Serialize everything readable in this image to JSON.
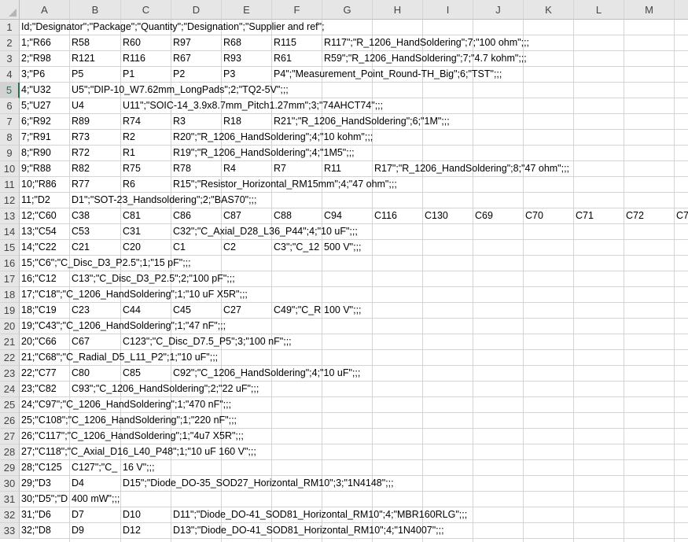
{
  "columns": [
    "A",
    "B",
    "C",
    "D",
    "E",
    "F",
    "G",
    "H",
    "I",
    "J",
    "K",
    "L",
    "M"
  ],
  "selected_row": 5,
  "rows": [
    {
      "n": "1",
      "cells": [
        "Id;\"Designator\";\"Package\";\"Quantity\";\"Designation\";\"Supplier and ref\";"
      ]
    },
    {
      "n": "2",
      "cells": [
        "1;\"R66",
        "R58",
        "R60",
        "R97",
        "R68",
        "R115",
        "R117\";\"R_1206_HandSoldering\";7;\"100 ohm\";;;"
      ]
    },
    {
      "n": "3",
      "cells": [
        "2;\"R98",
        "R121",
        "R116",
        "R67",
        "R93",
        "R61",
        "R59\";\"R_1206_HandSoldering\";7;\"4.7 kohm\";;;"
      ]
    },
    {
      "n": "4",
      "cells": [
        "3;\"P6",
        "P5",
        "P1",
        "P2",
        "P3",
        "P4\";\"Measurement_Point_Round-TH_Big\";6;\"TST\";;;"
      ]
    },
    {
      "n": "5",
      "cells": [
        "4;\"U32",
        "U5\";\"DIP-10_W7.62mm_LongPads\";2;\"TQ2-5V\";;;"
      ]
    },
    {
      "n": "6",
      "cells": [
        "5;\"U27",
        "U4",
        "U11\";\"SOIC-14_3.9x8.7mm_Pitch1.27mm\";3;\"74AHCT74\";;;"
      ]
    },
    {
      "n": "7",
      "cells": [
        "6;\"R92",
        "R89",
        "R74",
        "R3",
        "R18",
        "R21\";\"R_1206_HandSoldering\";6;\"1M\";;;"
      ]
    },
    {
      "n": "8",
      "cells": [
        "7;\"R91",
        "R73",
        "R2",
        "R20\";\"R_1206_HandSoldering\";4;\"10 kohm\";;;"
      ]
    },
    {
      "n": "9",
      "cells": [
        "8;\"R90",
        "R72",
        "R1",
        "R19\";\"R_1206_HandSoldering\";4;\"1M5\";;;"
      ]
    },
    {
      "n": "10",
      "cells": [
        "9;\"R88",
        "R82",
        "R75",
        "R78",
        "R4",
        "R7",
        "R11",
        "R17\";\"R_1206_HandSoldering\";8;\"47 ohm\";;;"
      ]
    },
    {
      "n": "11",
      "cells": [
        "10;\"R86",
        "R77",
        "R6",
        "R15\";\"Resistor_Horizontal_RM15mm\";4;\"47 ohm\";;;"
      ]
    },
    {
      "n": "12",
      "cells": [
        "11;\"D2",
        "D1\";\"SOT-23_Handsoldering\";2;\"BAS70\";;;"
      ]
    },
    {
      "n": "13",
      "cells": [
        "12;\"C60",
        "C38",
        "C81",
        "C86",
        "C87",
        "C88",
        "C94",
        "C116",
        "C130",
        "C69",
        "C70",
        "C71",
        "C72",
        "C7"
      ]
    },
    {
      "n": "14",
      "cells": [
        "13;\"C54",
        "C53",
        "C31",
        "C32\";\"C_Axial_D28_L36_P44\";4;\"10 uF\";;;"
      ]
    },
    {
      "n": "15",
      "cells": [
        "14;\"C22",
        "C21",
        "C20",
        "C1",
        "C2",
        "C3\";\"C_12",
        "500 V\";;;"
      ]
    },
    {
      "n": "16",
      "cells": [
        "15;\"C6\";\"C_Disc_D3_P2.5\";1;\"15 pF\";;;"
      ]
    },
    {
      "n": "17",
      "cells": [
        "16;\"C12",
        "C13\";\"C_Disc_D3_P2.5\";2;\"100 pF\";;;"
      ]
    },
    {
      "n": "18",
      "cells": [
        "17;\"C18\";\"C_1206_HandSoldering\";1;\"10 uF X5R\";;;"
      ]
    },
    {
      "n": "19",
      "cells": [
        "18;\"C19",
        "C23",
        "C44",
        "C45",
        "C27",
        "C49\";\"C_R",
        "100 V\";;;"
      ]
    },
    {
      "n": "20",
      "cells": [
        "19;\"C43\";\"C_1206_HandSoldering\";1;\"47 nF\";;;"
      ]
    },
    {
      "n": "21",
      "cells": [
        "20;\"C66",
        "C67",
        "C123\";\"C_Disc_D7.5_P5\";3;\"100 nF\";;;"
      ]
    },
    {
      "n": "22",
      "cells": [
        "21;\"C68\";\"C_Radial_D5_L11_P2\";1;\"10 uF\";;;"
      ]
    },
    {
      "n": "23",
      "cells": [
        "22;\"C77",
        "C80",
        "C85",
        "C92\";\"C_1206_HandSoldering\";4;\"10 uF\";;;"
      ]
    },
    {
      "n": "24",
      "cells": [
        "23;\"C82",
        "C93\";\"C_1206_HandSoldering\";2;\"22 uF\";;;"
      ]
    },
    {
      "n": "25",
      "cells": [
        "24;\"C97\";\"C_1206_HandSoldering\";1;\"470 nF\";;;"
      ]
    },
    {
      "n": "26",
      "cells": [
        "25;\"C108\";\"C_1206_HandSoldering\";1;\"220 nF\";;;"
      ]
    },
    {
      "n": "27",
      "cells": [
        "26;\"C117\";\"C_1206_HandSoldering\";1;\"4u7 X5R\";;;"
      ]
    },
    {
      "n": "28",
      "cells": [
        "27;\"C118\";\"C_Axial_D16_L40_P48\";1;\"10 uF 160 V\";;;"
      ]
    },
    {
      "n": "29",
      "cells": [
        "28;\"C125",
        "C127\";\"C_",
        "16 V\";;;"
      ]
    },
    {
      "n": "30",
      "cells": [
        "29;\"D3",
        "D4",
        "D15\";\"Diode_DO-35_SOD27_Horizontal_RM10\";3;\"1N4148\";;;"
      ]
    },
    {
      "n": "31",
      "cells": [
        "30;\"D5\";\"D",
        "400 mW\";;;"
      ]
    },
    {
      "n": "32",
      "cells": [
        "31;\"D6",
        "D7",
        "D10",
        "D11\";\"Diode_DO-41_SOD81_Horizontal_RM10\";4;\"MBR160RLG\";;;"
      ]
    },
    {
      "n": "33",
      "cells": [
        "32;\"D8",
        "D9",
        "D12",
        "D13\";\"Diode_DO-41_SOD81_Horizontal_RM10\";4;\"1N4007\";;;"
      ]
    }
  ]
}
